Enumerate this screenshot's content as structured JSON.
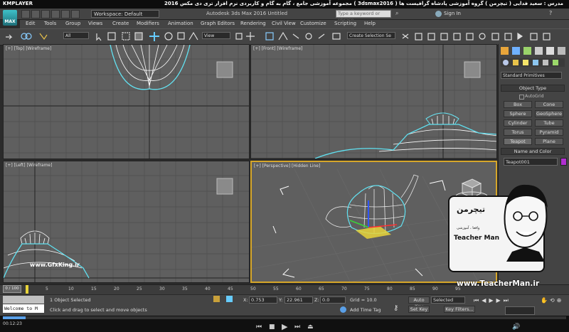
{
  "player": {
    "logo": "KMPLAYER",
    "title": "مجموعه آموزشی جامع ، گام به گام و کاربردی نرم افزار تری دی مکس 2016 ( 3dsmax2016 ) مدرس : سعید فدایی ( تیچرمن ) گروه آموزشی پادشاه گرافیست ها"
  },
  "titlebar": {
    "logo": "MAX",
    "workspace": "Workspace: Default",
    "app_title": "Autodesk 3ds Max 2016    Untitled",
    "search_placeholder": "Type a keyword or phrase",
    "sign_in": "Sign In"
  },
  "menu": [
    "Edit",
    "Tools",
    "Group",
    "Views",
    "Create",
    "Modifiers",
    "Animation",
    "Graph Editors",
    "Rendering",
    "Civil View",
    "Customize",
    "Scripting",
    "Help"
  ],
  "toolbar": {
    "selection_filter": "All",
    "ref_coord": "View",
    "selection_set": "Create Selection Se"
  },
  "viewports": {
    "top": "[+] [Top] [Wireframe]",
    "front": "[+] [Front] [Wireframe]",
    "left": "[+] [Left] [Wireframe]",
    "perspective": "[+] [Perspective] [Hidden Line]"
  },
  "command_panel": {
    "category": "Standard Primitives",
    "object_type_header": "Object Type",
    "autogrid": "AutoGrid",
    "primitives": [
      "Box",
      "Cone",
      "Sphere",
      "GeoSphere",
      "Cylinder",
      "Tube",
      "Torus",
      "Pyramid",
      "Teapot",
      "Plane"
    ],
    "name_color_header": "Name and Color",
    "object_name": "Teapot001",
    "object_color": "#b12fd1"
  },
  "timeline": {
    "frame_counter": "0 / 100",
    "ticks": [
      "5",
      "10",
      "15",
      "20",
      "25",
      "30",
      "35",
      "40",
      "45",
      "50",
      "55",
      "60",
      "65",
      "70",
      "75",
      "80",
      "85",
      "90",
      "95"
    ]
  },
  "status": {
    "maxscript": "Welcome to M",
    "selected": "1 Object Selected",
    "prompt": "Click and drag to select and move objects",
    "x_label": "X:",
    "x_value": "0.753",
    "y_label": "Y:",
    "y_value": "22.961",
    "z_label": "Z:",
    "z_value": "0.0",
    "grid": "Grid = 10.0",
    "auto_key": "Auto Key",
    "set_key": "Set Key",
    "add_time_tag": "Add Time Tag",
    "key_mode": "Selected",
    "key_filters": "Key Filters..."
  },
  "video": {
    "time": "00:12:23",
    "progress": 0.04
  },
  "overlays": {
    "watermark": "www.GfxKing.ir",
    "promo_url": "www.TeacherMan.ir",
    "card_brand": "تیچرمن",
    "card_name": "Teacher Man",
    "card_sub": "واقعا ، آموزشی"
  }
}
